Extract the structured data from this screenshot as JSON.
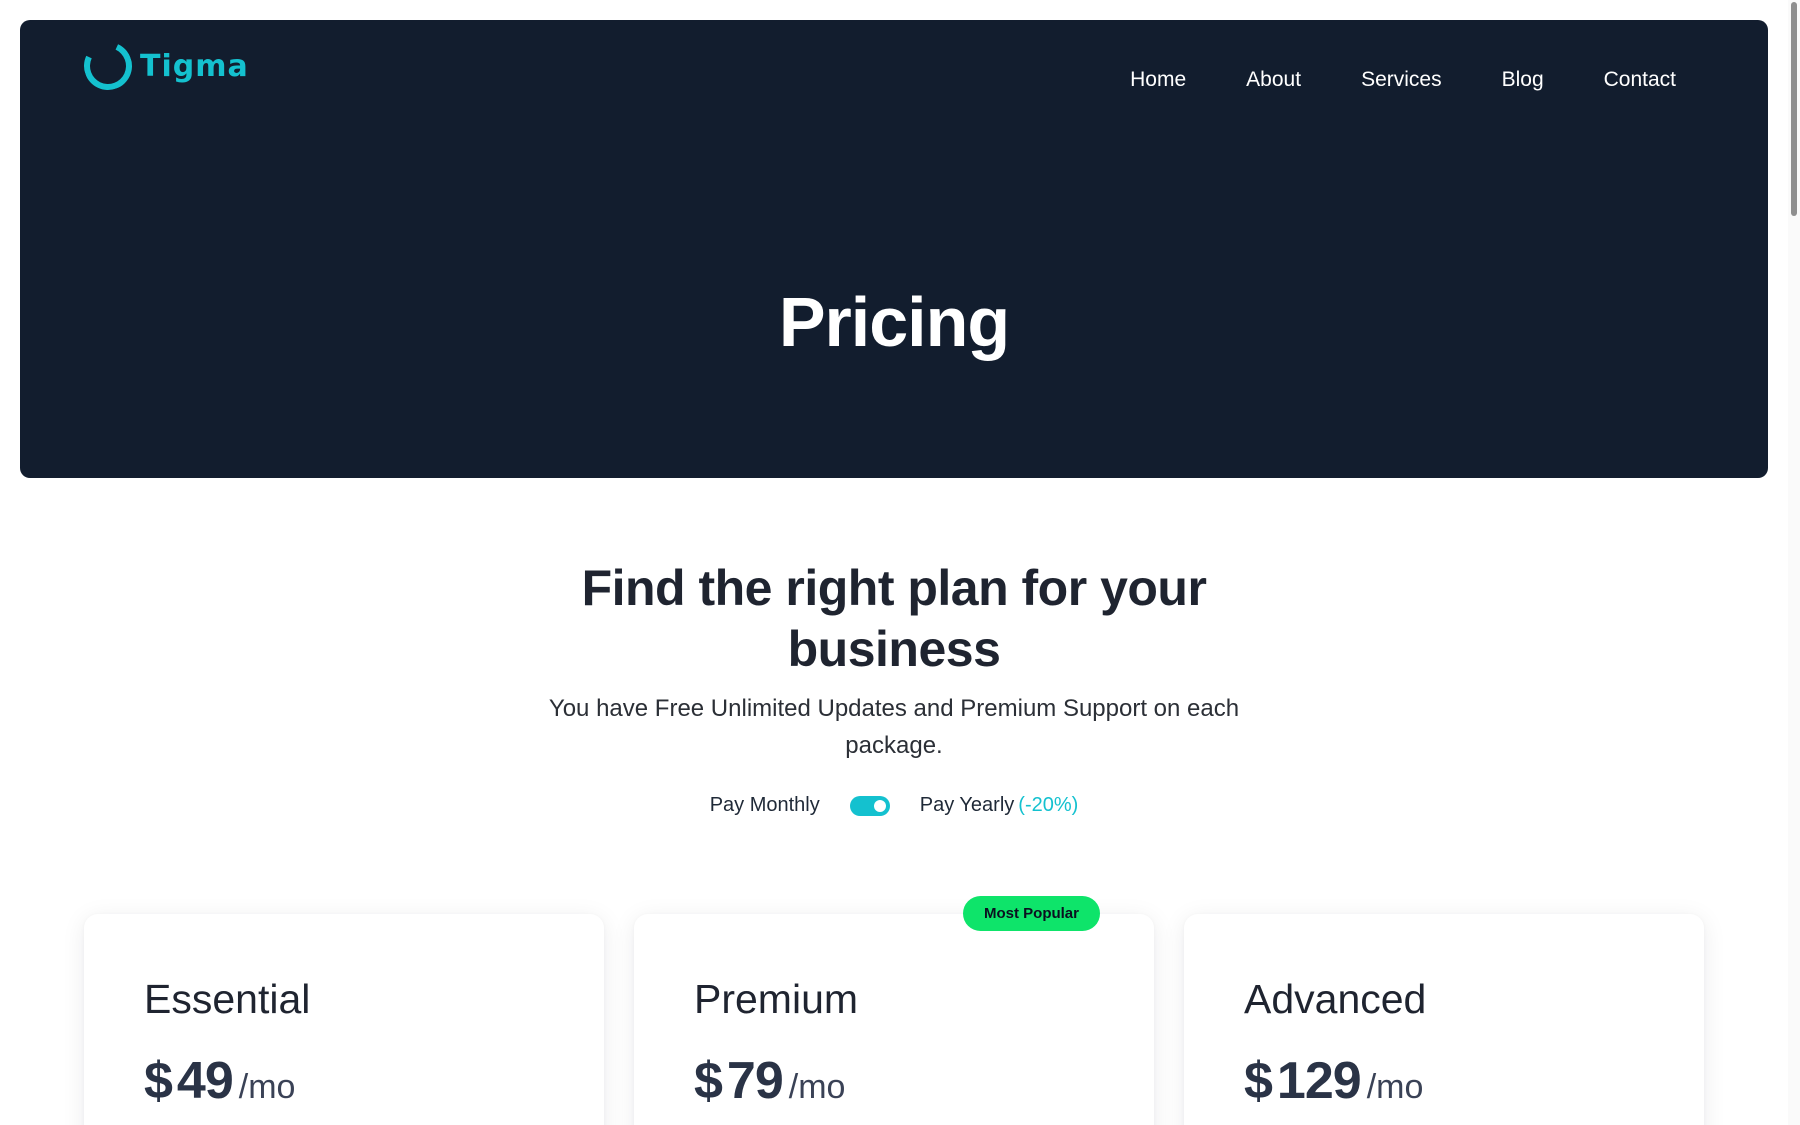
{
  "brand": {
    "name": "Tigma",
    "icon": "ring-logo-icon",
    "color": "#14c1cf"
  },
  "nav": {
    "items": [
      {
        "label": "Home"
      },
      {
        "label": "About"
      },
      {
        "label": "Services"
      },
      {
        "label": "Blog"
      },
      {
        "label": "Contact"
      }
    ]
  },
  "hero": {
    "title": "Pricing",
    "background": "#121d2e"
  },
  "intro": {
    "heading": "Find the right plan for your business",
    "subtitle": "You have Free Unlimited Updates and Premium Support on each package."
  },
  "billing": {
    "monthly_label": "Pay Monthly",
    "yearly_label": "Pay Yearly",
    "discount_label": "(-20%)",
    "toggle_state": "on"
  },
  "plans": [
    {
      "name": "Essential",
      "currency": "$",
      "amount": "49",
      "period": "/mo",
      "badge": ""
    },
    {
      "name": "Premium",
      "currency": "$",
      "amount": "79",
      "period": "/mo",
      "badge": "Most Popular"
    },
    {
      "name": "Advanced",
      "currency": "$",
      "amount": "129",
      "period": "/mo",
      "badge": ""
    }
  ],
  "colors": {
    "accent": "#14c1cf",
    "badge": "#0ee46a",
    "text_dark": "#1f2430"
  }
}
